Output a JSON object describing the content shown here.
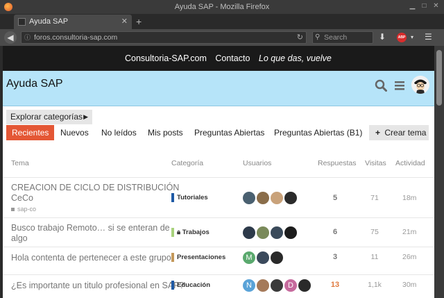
{
  "window": {
    "title": "Ayuda SAP - Mozilla Firefox"
  },
  "tab": {
    "title": "Ayuda SAP"
  },
  "url": "foros.consultoria-sap.com",
  "search_placeholder": "Search",
  "site_bar": {
    "links": [
      "Consultoria-SAP.com",
      "Contacto"
    ],
    "slogan": "Lo que das, vuelve"
  },
  "header": {
    "logo": "Ayuda SAP"
  },
  "categories_button": "Explorar categorías",
  "nav": [
    "Recientes",
    "Nuevos",
    "No leídos",
    "Mis posts",
    "Preguntas Abiertas",
    "Preguntas Abiertas (B1)"
  ],
  "new_topic": "Crear tema",
  "columns": [
    "Tema",
    "Categoría",
    "Usuarios",
    "Respuestas",
    "Visitas",
    "Actividad"
  ],
  "topics": [
    {
      "title_lines": [
        "CREACION DE CICLO DE DISTRIBUCIÓN",
        "CeCo"
      ],
      "tag": "sap-co",
      "category": "Tutoriales",
      "category_color": "#1f5aa5",
      "locked": false,
      "replies": "5",
      "views": "71",
      "activity": "18m",
      "users": [
        "#4a6070",
        "#8a6d4a",
        "#c9a27a",
        "#2b2b2b"
      ]
    },
    {
      "title_lines": [
        "Busco trabajo Remoto… si se enteran de",
        "algo"
      ],
      "tag": "",
      "category": "Trabajos",
      "category_color": "#a8d27c",
      "locked": true,
      "replies": "6",
      "views": "75",
      "activity": "21m",
      "users": [
        "#2d3a4a",
        "#7a8a5a",
        "#3a4a5a",
        "#1c1c1c"
      ]
    },
    {
      "title_lines": [
        "Hola contenta de pertenecer a este grupo"
      ],
      "tag": "",
      "category": "Presentaciones",
      "category_color": "#c4985a",
      "locked": false,
      "replies": "3",
      "views": "11",
      "activity": "26m",
      "users": [
        "#5aa96e",
        "#3b4a5c",
        "#2a2a2a"
      ],
      "user_letters": [
        "M",
        "",
        ""
      ]
    },
    {
      "title_lines": [
        "¿Es importante un titulo profesional en SAP?"
      ],
      "tag": "",
      "category": "Educación",
      "category_color": "#1f5aa5",
      "locked": false,
      "replies": "13",
      "replies_color": "#e0793e",
      "views": "1,1k",
      "activity": "30m",
      "users": [
        "#5aa3d8",
        "#a57a5a",
        "#3a3a3a",
        "#c66a9d",
        "#2a2a2a"
      ],
      "user_letters": [
        "N",
        "",
        "",
        "D",
        ""
      ]
    }
  ]
}
